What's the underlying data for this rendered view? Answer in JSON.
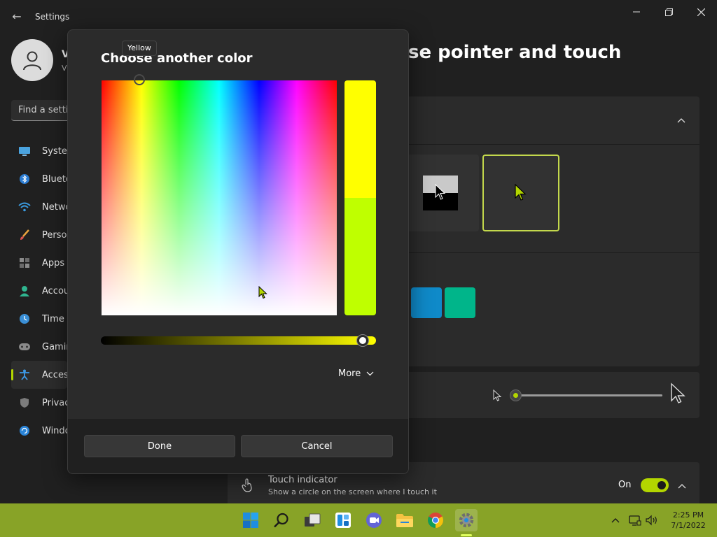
{
  "window": {
    "title": "Settings",
    "back_glyph": "←"
  },
  "profile": {
    "name_visible": "V",
    "sub_visible": "V"
  },
  "search": {
    "placeholder": "Find a setti"
  },
  "nav": {
    "items": [
      {
        "label": "Syster",
        "icon": "monitor-icon"
      },
      {
        "label": "Blueto",
        "icon": "bluetooth-icon"
      },
      {
        "label": "Netwo",
        "icon": "wifi-icon"
      },
      {
        "label": "Person",
        "icon": "brush-icon"
      },
      {
        "label": "Apps",
        "icon": "apps-icon"
      },
      {
        "label": "Accou",
        "icon": "account-icon"
      },
      {
        "label": "Time &",
        "icon": "clock-icon"
      },
      {
        "label": "Gamin",
        "icon": "gamepad-icon"
      },
      {
        "label": "Access",
        "icon": "accessibility-icon",
        "active": true
      },
      {
        "label": "Privac",
        "icon": "shield-icon"
      },
      {
        "label": "Windo",
        "icon": "update-icon"
      }
    ]
  },
  "page": {
    "title_visible": "se pointer and touch"
  },
  "pointer_colors": [
    "#0f8ac9",
    "#00b58a"
  ],
  "touch": {
    "title": "Touch indicator",
    "subtitle": "Show a circle on the screen where I touch it",
    "toggle_label": "On"
  },
  "dialog": {
    "title": "Choose another color",
    "tooltip": "Yellow",
    "more_label": "More",
    "done_label": "Done",
    "cancel_label": "Cancel",
    "new_color": "#ffff00",
    "current_color": "#bfff00",
    "value_level": 0.97
  },
  "taskbar": {
    "time": "2:25 PM",
    "date": "7/1/2022",
    "apps": [
      "start-icon",
      "search-icon",
      "task-view-icon",
      "widgets-icon",
      "teams-chat-icon",
      "file-explorer-icon",
      "chrome-icon",
      "settings-icon"
    ]
  },
  "accent": "#b3d600"
}
